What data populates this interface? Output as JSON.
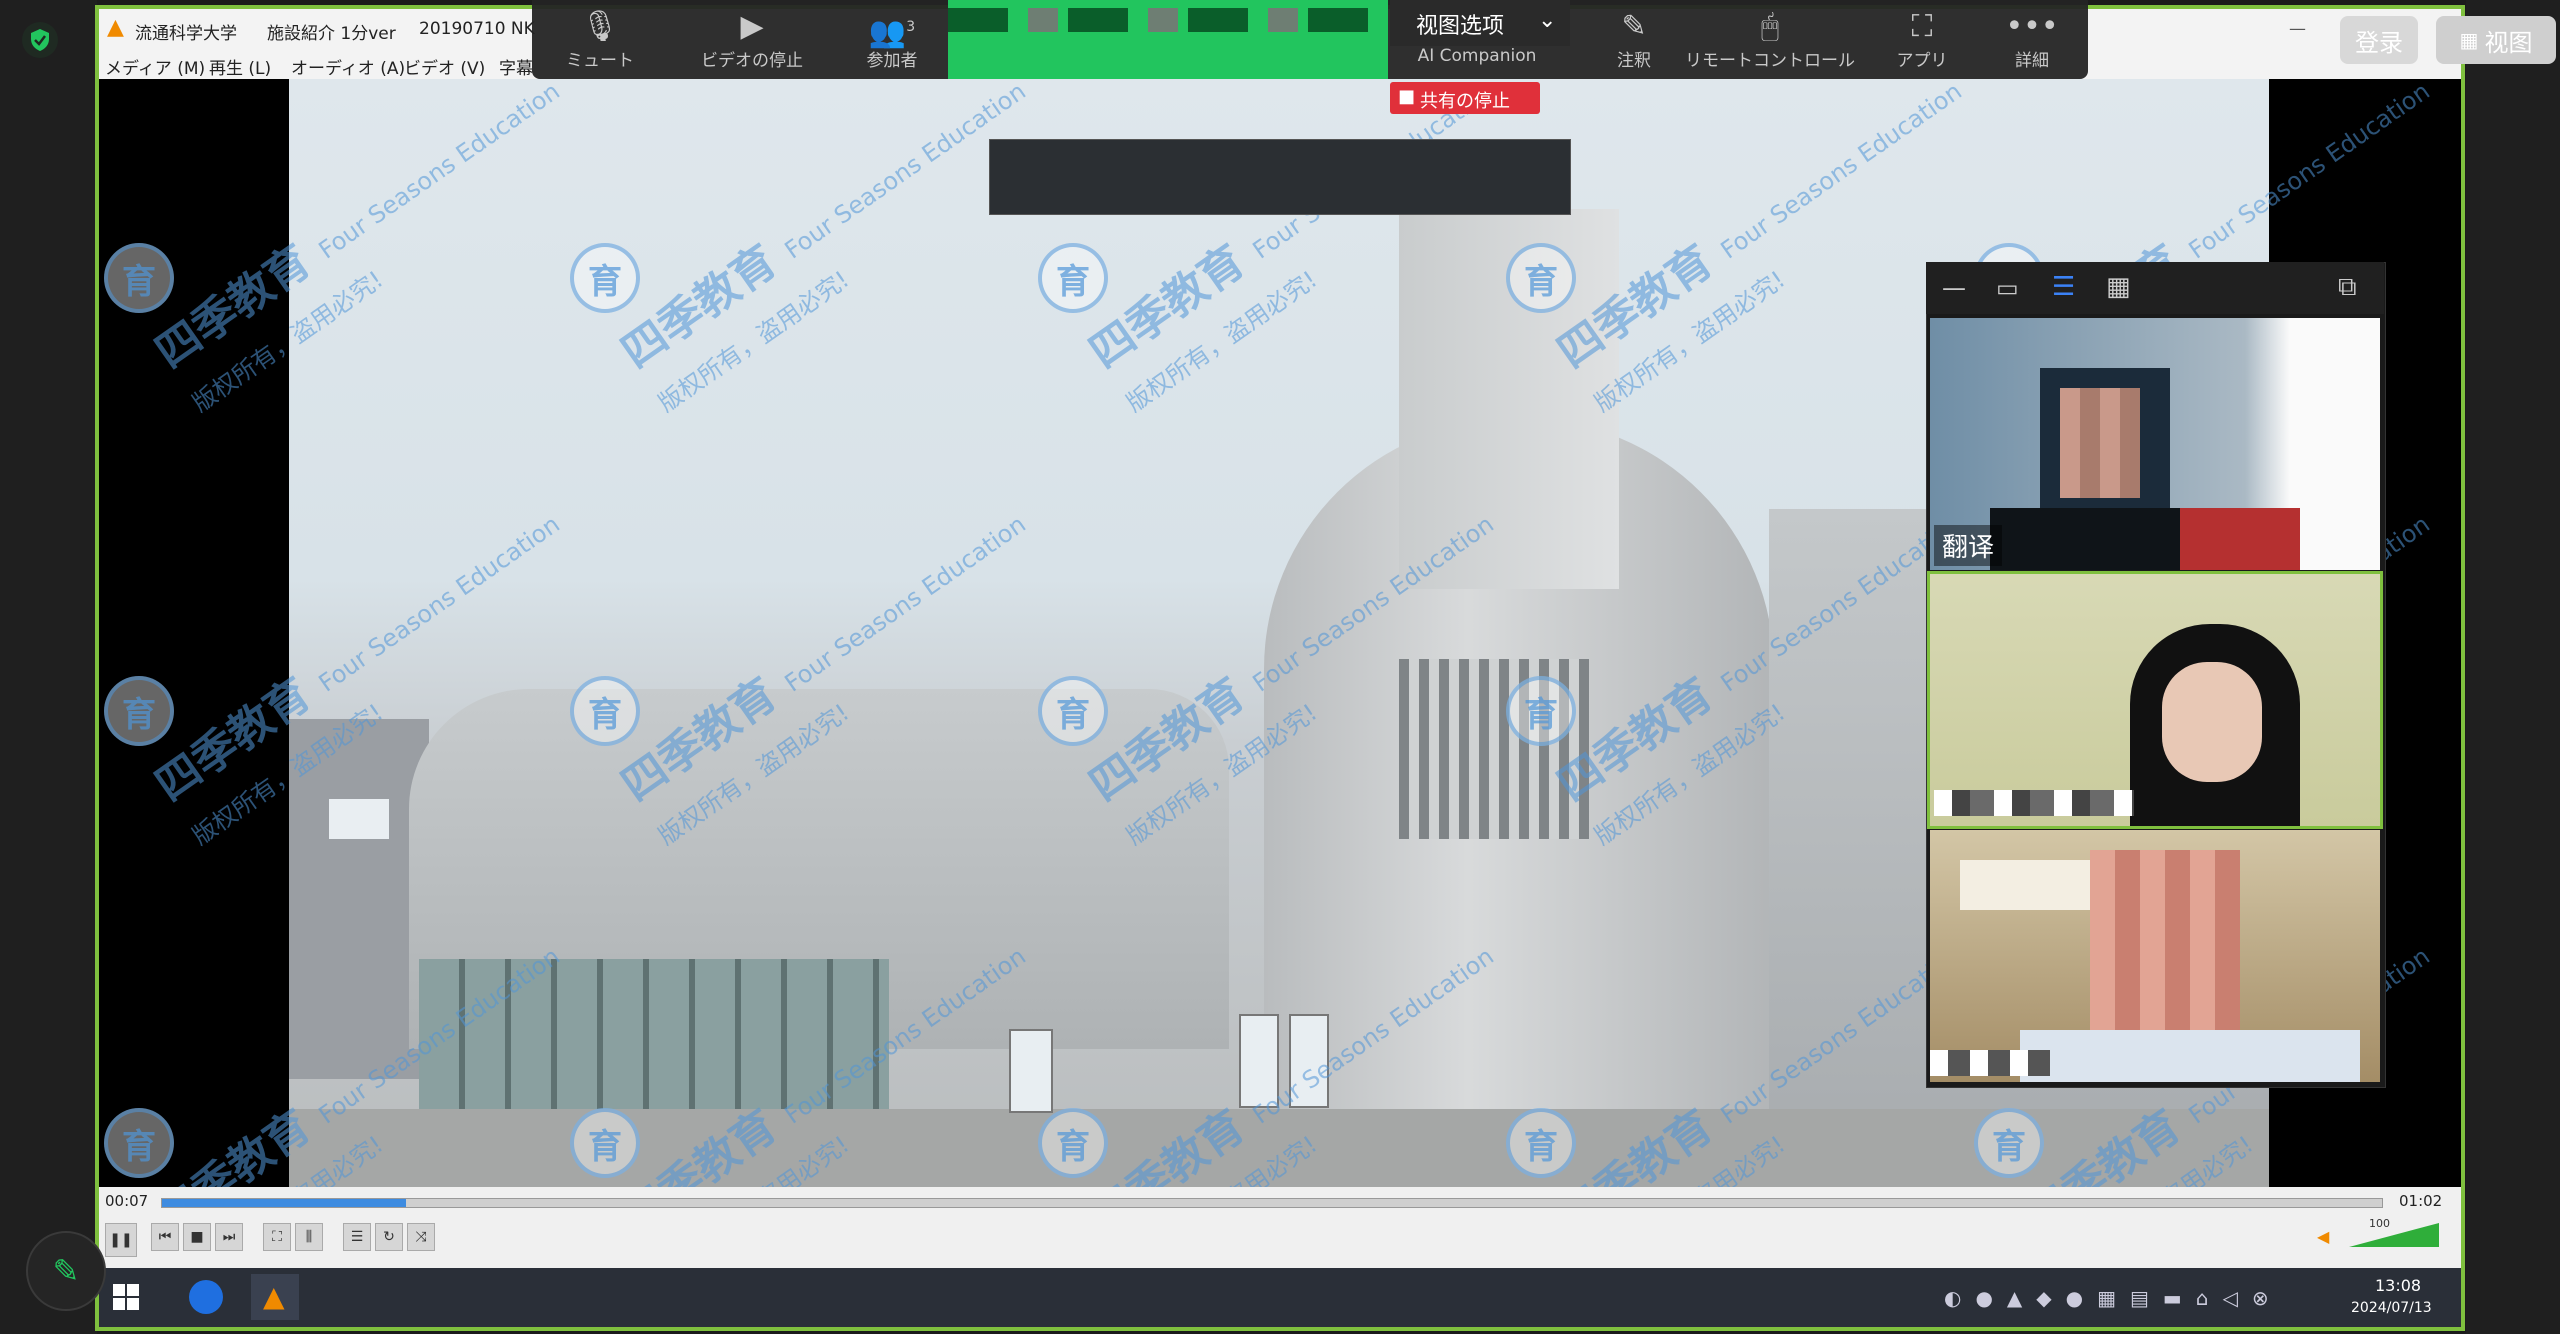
{
  "vlc": {
    "title_app": "流通科学大学",
    "title_file": "施設紹介 1分ver",
    "title_date": "20190710 NK",
    "menu": [
      "メディア (M)",
      "再生 (L)",
      "オーディオ (A)",
      "ビデオ (V)",
      "字幕"
    ],
    "time_elapsed": "00:07",
    "time_total": "01:02",
    "progress_fraction": 0.11,
    "volume_label": "100"
  },
  "zoom_toolbar": {
    "buttons": [
      {
        "label": "ミュート",
        "icon": "microphone-icon"
      },
      {
        "label": "ビデオの停止",
        "icon": "video-camera-icon"
      },
      {
        "label": "参加者",
        "icon": "participants-icon",
        "count": "3"
      },
      {
        "label": "AI Companion",
        "icon": "ai-companion-icon"
      },
      {
        "label": "注釈",
        "icon": "annotate-icon"
      },
      {
        "label": "リモートコントロール",
        "icon": "remote-control-icon"
      },
      {
        "label": "アプリ",
        "icon": "apps-icon"
      },
      {
        "label": "詳細",
        "icon": "more-icon"
      }
    ],
    "view_options": "视图选项",
    "stop_share": "共有の停止"
  },
  "top_right": {
    "login": "登录",
    "view": "视图"
  },
  "participants": {
    "tile1_label": "翻译"
  },
  "watermark": {
    "brand": "四季教育",
    "english": "Four Seasons Education",
    "notice": "版权所有，盗用必究!",
    "seal": "育"
  },
  "taskbar": {
    "time": "13:08",
    "date": "2024/07/13"
  },
  "colors": {
    "share_border": "#7fc03e",
    "share_status": "#22c55e",
    "stop_share": "#e0303a",
    "watermark": "#5096d7"
  }
}
